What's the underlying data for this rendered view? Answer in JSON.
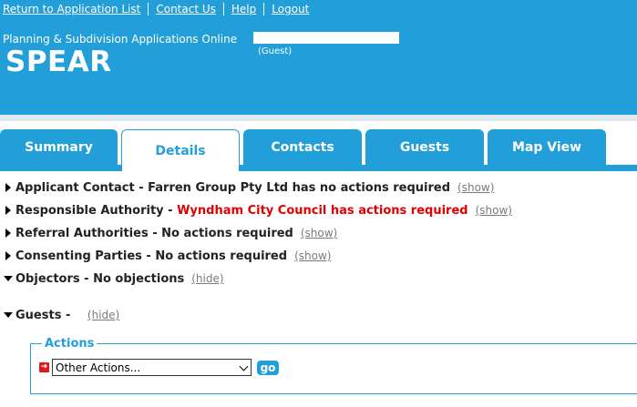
{
  "header": {
    "links": [
      "Return to Application List",
      "Contact Us",
      "Help",
      "Logout"
    ],
    "subtitle": "Planning & Subdivision Applications Online",
    "logo": "SPEAR",
    "guest_label": "(Guest)"
  },
  "tabs": [
    {
      "label": "Summary",
      "active": false
    },
    {
      "label": "Details",
      "active": true
    },
    {
      "label": "Contacts",
      "active": false
    },
    {
      "label": "Guests",
      "active": false
    },
    {
      "label": "Map View",
      "active": false
    }
  ],
  "sections": [
    {
      "title": "Applicant Contact",
      "sep": " - ",
      "status": "Farren Group Pty Ltd has no actions required",
      "toggle": "(show)",
      "expanded": false,
      "alert": false
    },
    {
      "title": "Responsible Authority",
      "sep": " - ",
      "status": "Wyndham City Council has actions required",
      "toggle": "(show)",
      "expanded": false,
      "alert": true
    },
    {
      "title": "Referral Authorities",
      "sep": " - ",
      "status": "No actions required",
      "toggle": "(show)",
      "expanded": false,
      "alert": false
    },
    {
      "title": "Consenting Parties",
      "sep": " - ",
      "status": "No actions required",
      "toggle": "(show)",
      "expanded": false,
      "alert": false
    },
    {
      "title": "Objectors",
      "sep": " - ",
      "status": "No objections",
      "toggle": "(hide)",
      "expanded": true,
      "alert": false
    },
    {
      "title": "Guests",
      "sep": " - ",
      "status": "",
      "toggle": "(hide)",
      "expanded": true,
      "alert": false
    }
  ],
  "actions": {
    "legend": "Actions",
    "select_value": "Other Actions...",
    "go_label": "go"
  },
  "colors": {
    "accent": "#229ed9",
    "alert": "#e00000"
  }
}
